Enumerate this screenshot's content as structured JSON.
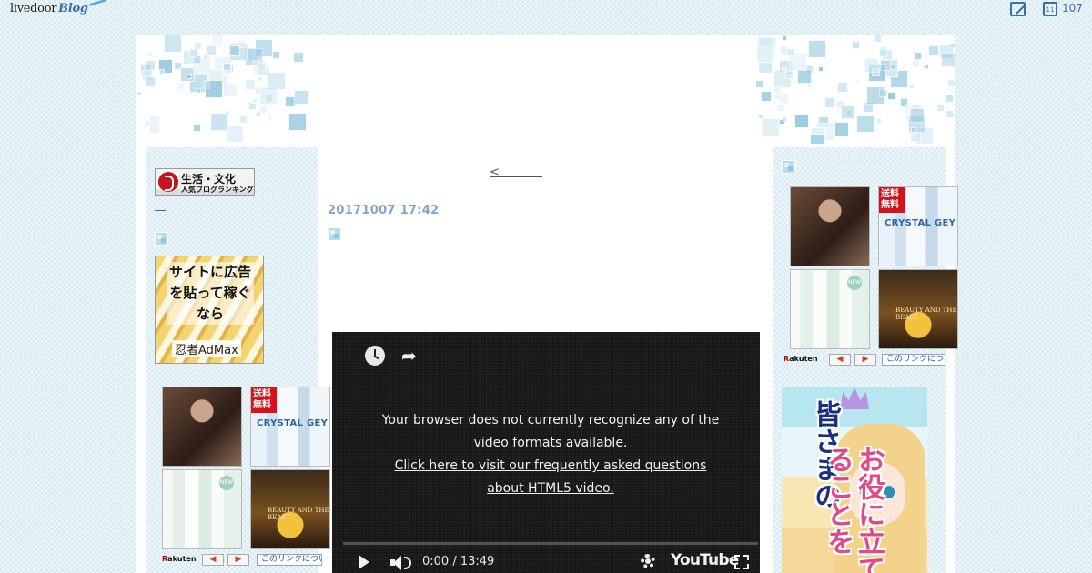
{
  "topbar": {
    "logo_text": "livedoor",
    "logo_sub": "Blog",
    "calendar_day": "11",
    "count": "107"
  },
  "left_sidebar": {
    "ranking_banner_line1": "生活・文化",
    "ranking_banner_line2": "人気ブログランキング",
    "link_text": "—",
    "admax_copy": "サイトに広告を貼って稼ぐなら",
    "admax_brand": "忍者AdMax"
  },
  "rakuten_widget": {
    "badge": "送料無料",
    "water_brand": "CRYSTAL GEY",
    "bottle_badge": "NEW",
    "movie_title": "BEAUTY AND THE BEAST",
    "logo": "Rakuten",
    "prev": "◀",
    "next": "▶",
    "about_link": "このリンクについて"
  },
  "right_sidebar": {
    "game_ad_text_blue": "皆さまの",
    "game_ad_text_pink": "お役に立てることを"
  },
  "post": {
    "prev_link": "<         ",
    "date": "20171007 17:42"
  },
  "video": {
    "message": "Your browser does not currently recognize any of the video formats available.",
    "faq_link": "Click here to visit our frequently asked questions about HTML5 video.",
    "time": "0:00 / 13:49",
    "brand": "YouTube"
  },
  "colors": {
    "accent": "#3a6db0",
    "date": "#7ea6d0",
    "video_bg": "#181818"
  }
}
